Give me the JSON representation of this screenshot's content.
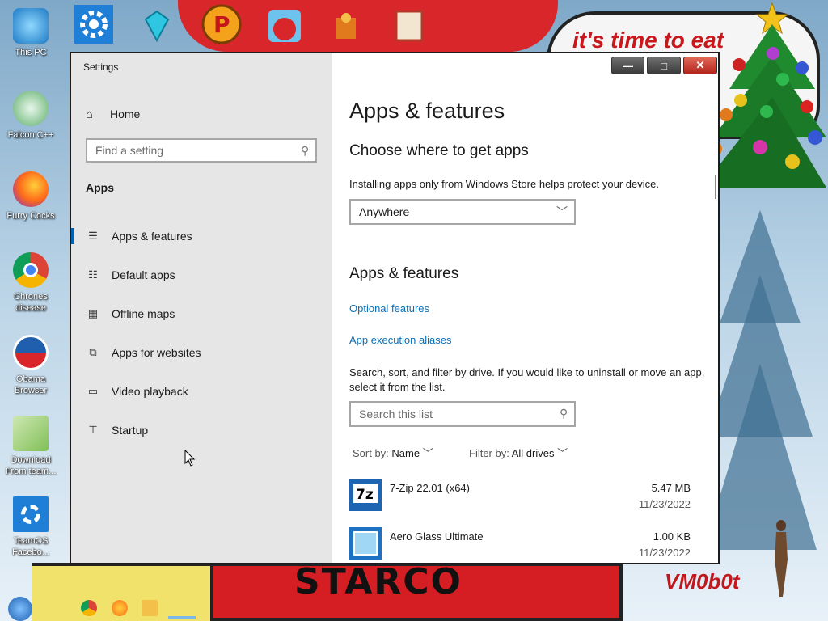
{
  "desktop": {
    "icons": [
      {
        "label": "This PC",
        "icon": "monitor-icon"
      },
      {
        "label": "Falcon C++",
        "icon": "recycle-icon"
      },
      {
        "label": "Furry Cocks",
        "icon": "firefox-icon"
      },
      {
        "label": "Chrones disease",
        "icon": "chrome-icon"
      },
      {
        "label": "Obama Browser",
        "icon": "obama-logo-icon"
      },
      {
        "label": "Download From team...",
        "icon": "notepad-icon"
      },
      {
        "label": "TeamOS Facebo...",
        "icon": "gear-icon"
      }
    ],
    "wallpaper_text": "it's time to eat",
    "banner_text": "STARCO",
    "signature": "VM0b0t"
  },
  "window": {
    "title": "Settings",
    "controls": {
      "minimize": "—",
      "maximize": "□",
      "close": "✕"
    }
  },
  "sidebar": {
    "home_label": "Home",
    "find_placeholder": "Find a setting",
    "section_title": "Apps",
    "items": [
      {
        "label": "Apps & features",
        "icon": "list-icon",
        "active": true
      },
      {
        "label": "Default apps",
        "icon": "default-apps-icon",
        "active": false
      },
      {
        "label": "Offline maps",
        "icon": "map-icon",
        "active": false
      },
      {
        "label": "Apps for websites",
        "icon": "web-app-icon",
        "active": false
      },
      {
        "label": "Video playback",
        "icon": "video-icon",
        "active": false
      },
      {
        "label": "Startup",
        "icon": "startup-icon",
        "active": false
      }
    ]
  },
  "main": {
    "title": "Apps & features",
    "choose_heading": "Choose where to get apps",
    "choose_desc": "Installing apps only from Windows Store helps protect your device.",
    "source_select": "Anywhere",
    "section_heading": "Apps & features",
    "links": [
      "Optional features",
      "App execution aliases"
    ],
    "search_desc": "Search, sort, and filter by drive. If you would like to uninstall or move an app, select it from the list.",
    "search_placeholder": "Search this list",
    "sort_label": "Sort by:",
    "sort_value": "Name",
    "filter_label": "Filter by:",
    "filter_value": "All drives",
    "apps": [
      {
        "name": "7-Zip 22.01 (x64)",
        "size": "5.47 MB",
        "date": "11/23/2022",
        "icon": "7zip-icon"
      },
      {
        "name": "Aero Glass Ultimate",
        "size": "1.00 KB",
        "date": "11/23/2022",
        "icon": "aero-glass-icon"
      }
    ]
  },
  "colors": {
    "accent": "#0063b1",
    "link": "#0a6fb8",
    "sidebar_bg": "#e6e6e6"
  }
}
